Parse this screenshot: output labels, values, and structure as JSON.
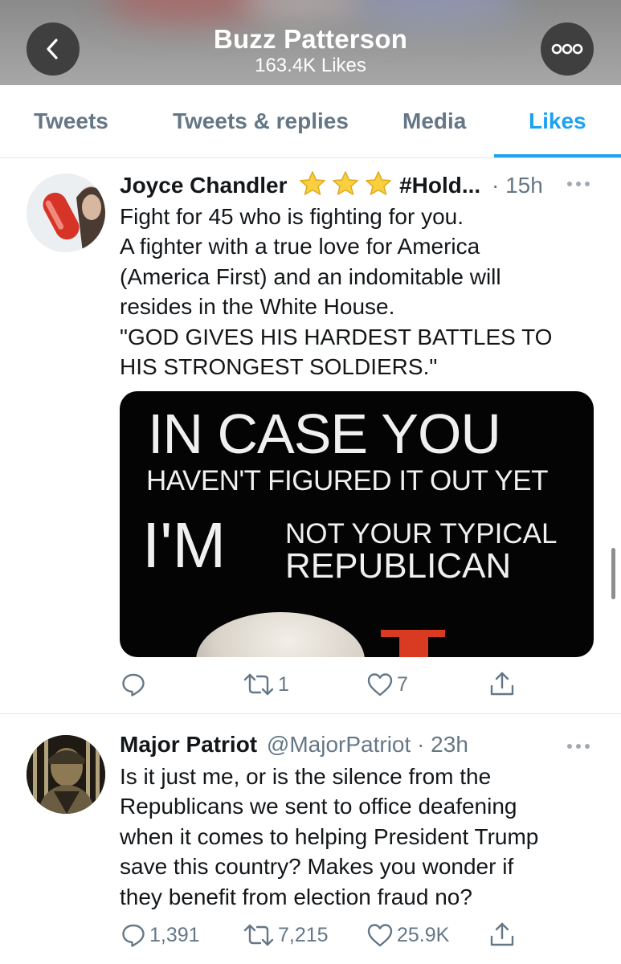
{
  "header": {
    "title": "Buzz Patterson",
    "subtitle": "163.4K Likes",
    "back_icon": "chevron-left-icon",
    "more_icon": "more-horizontal-icon"
  },
  "tabs": [
    {
      "label": "Tweets",
      "active": false
    },
    {
      "label": "Tweets & replies",
      "active": false
    },
    {
      "label": "Media",
      "active": false
    },
    {
      "label": "Likes",
      "active": true
    }
  ],
  "colors": {
    "accent": "#1da1f2",
    "secondary_text": "#657786",
    "primary_text": "#14171a"
  },
  "tweets": [
    {
      "name": "Joyce Chandler",
      "name_suffix": "#Hold...",
      "stars": 3,
      "handle": "",
      "time": "· 15h",
      "lines": [
        "Fight for 45 who is fighting for you.",
        "A fighter with a true love for America",
        "(America First) and an indomitable will",
        "resides in the White House.",
        "\"GOD GIVES HIS HARDEST BATTLES TO",
        "HIS STRONGEST SOLDIERS.\""
      ],
      "media": {
        "line1": "IN CASE YOU",
        "line2": "HAVEN'T FIGURED IT OUT YET",
        "line3": "I'M",
        "line4": "NOT YOUR TYPICAL",
        "line5": "REPUBLICAN"
      },
      "replies": "",
      "retweets": "1",
      "likes": "7"
    },
    {
      "name": "Major Patriot",
      "handle": "@MajorPatriot",
      "time": "· 23h",
      "lines": [
        "Is it just me, or is the silence from the",
        "Republicans we sent to office deafening",
        "when it comes to helping President Trump",
        "save this country?  Makes you wonder if",
        "they benefit from election fraud no?"
      ],
      "replies": "1,391",
      "retweets": "7,215",
      "likes": "25.9K"
    }
  ]
}
